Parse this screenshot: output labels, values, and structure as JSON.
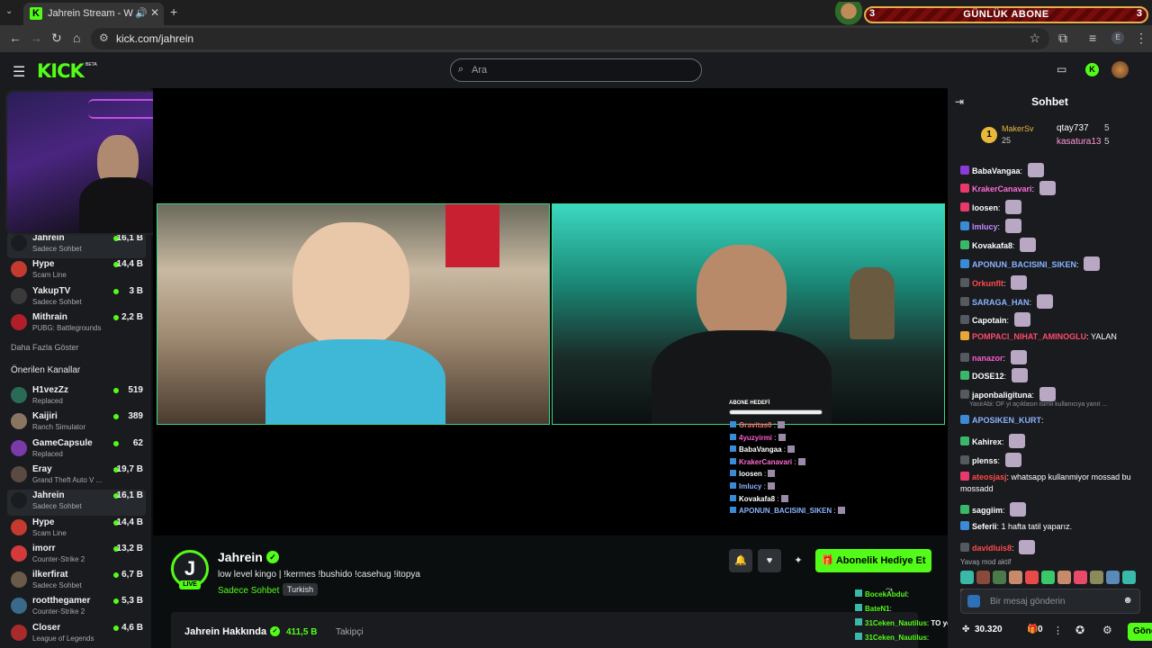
{
  "browser": {
    "tab_title": "Jahrein Stream - Watch Live",
    "url": "kick.com/jahrein",
    "new_tab_symbol": "+"
  },
  "sub_goal": {
    "label": "GÜNLÜK ABONE",
    "current": "3",
    "target": "3"
  },
  "header": {
    "logo": "KICK",
    "logo_badge": "BETA",
    "search_placeholder": "Ara"
  },
  "sidebar": {
    "followed": [
      {
        "name": "Jahrein",
        "sub": "Sadece Sohbet",
        "viewers": "16,1 B",
        "color": "#1a1d20"
      },
      {
        "name": "Hype",
        "sub": "Scam Line",
        "viewers": "14,4 B",
        "color": "#c43a2f"
      },
      {
        "name": "YakupTV",
        "sub": "Sadece Sohbet",
        "viewers": "3 B",
        "color": "#3a3a3a"
      },
      {
        "name": "Mithrain",
        "sub": "PUBG: Battlegrounds",
        "viewers": "2,2 B",
        "color": "#b01e2a"
      }
    ],
    "show_more": "Daha Fazla Göster",
    "recommended_title": "Önerilen Kanallar",
    "recommended": [
      {
        "name": "H1vezZz",
        "sub": "Replaced",
        "viewers": "519",
        "color": "#2a6b55"
      },
      {
        "name": "Kaijiri",
        "sub": "Ranch Simulator",
        "viewers": "389",
        "color": "#8a7560"
      },
      {
        "name": "GameCapsule",
        "sub": "Replaced",
        "viewers": "62",
        "color": "#7a3aa8"
      },
      {
        "name": "Eray",
        "sub": "Grand Theft Auto V ...",
        "viewers": "19,7 B",
        "color": "#5a4a42"
      },
      {
        "name": "Jahrein",
        "sub": "Sadece Sohbet",
        "viewers": "16,1 B",
        "color": "#1a1d20"
      },
      {
        "name": "Hype",
        "sub": "Scam Line",
        "viewers": "14,4 B",
        "color": "#c43a2f"
      },
      {
        "name": "imorr",
        "sub": "Counter-Strike 2",
        "viewers": "13,2 B",
        "color": "#d43a3a"
      },
      {
        "name": "ilkerfirat",
        "sub": "Sadece Sohbet",
        "viewers": "6,7 B",
        "color": "#6a5a4a"
      },
      {
        "name": "rootthegamer",
        "sub": "Counter-Strike 2",
        "viewers": "5,3 B",
        "color": "#3a6a8a"
      },
      {
        "name": "Closer",
        "sub": "League of Legends",
        "viewers": "4,6 B",
        "color": "#a82a2a"
      }
    ]
  },
  "stream": {
    "goal_title": "ABONE HEDEFİ",
    "overlay_chat": [
      {
        "user": "Gravitas0",
        "color": "#ff6b6b"
      },
      {
        "user": "4yuzyirmi",
        "color": "#ff5ad1"
      },
      {
        "user": "BabaVangaa",
        "color": "#ffffff"
      },
      {
        "user": "KrakerCanavari",
        "color": "#ff6bd6"
      },
      {
        "user": "loosen",
        "color": "#ffffff"
      },
      {
        "user": "lmlucy",
        "color": "#8ab4ff"
      },
      {
        "user": "Kovakafa8",
        "color": "#ffffff"
      },
      {
        "user": "APONUN_BACISINI_SIKEN",
        "color": "#8ab4ff"
      }
    ],
    "overlay_chat_2": [
      {
        "user": "BocekAbdul",
        "text": "",
        "color": "#53fc18"
      },
      {
        "user": "BateN1",
        "text": "",
        "color": "#53fc18"
      },
      {
        "user": "31Ceken_Nautilus",
        "text": "TO yemişim",
        "color": "#53fc18"
      },
      {
        "user": "31Ceken_Nautilus",
        "text": "",
        "color": "#53fc18"
      }
    ]
  },
  "channel": {
    "avatar_letter": "J",
    "live": "LIVE",
    "name": "Jahrein",
    "title": "low level kingo | !kermes !bushido !casehug !itopya",
    "category": "Sadece Sohbet",
    "language": "Turkish",
    "gift_button": "Abonelik Hediye Et",
    "about_title": "Jahrein Hakkında",
    "followers": "411,5 B",
    "followers_label": "Takipçi"
  },
  "chat": {
    "title": "Sohbet",
    "leaderboard": [
      {
        "user": "MakerSv",
        "count": "25"
      },
      {
        "user": "qtay737",
        "count": "5"
      },
      {
        "user": "kasatura13",
        "count": "5"
      }
    ],
    "messages": [
      {
        "user": "BabaVangaa",
        "text": "",
        "color": "#ffffff",
        "badge": "#8a3ad6",
        "emote": true
      },
      {
        "user": "KrakerCanavari",
        "text": "",
        "color": "#ff6bd6",
        "badge": "#e83a6a",
        "emote": true
      },
      {
        "user": "loosen",
        "text": "",
        "color": "#ffffff",
        "badge": "#e83a6a",
        "emote": true
      },
      {
        "user": "lmlucy",
        "text": "",
        "color": "#c28bff",
        "badge": "#3a8ad6",
        "emote": true
      },
      {
        "user": "Kovakafa8",
        "text": "",
        "color": "#ffffff",
        "badge": "#3ab86a",
        "emote": true
      },
      {
        "user": "APONUN_BACISINI_SIKEN",
        "text": "",
        "color": "#8ab4ff",
        "badge": "#3a8ad6",
        "emote": true
      },
      {
        "user": "Orkunflt",
        "text": "",
        "color": "#ff4a4a",
        "badge": "#555a60",
        "emote": true
      },
      {
        "user": "SARAGA_HAN",
        "text": "",
        "color": "#8ab4ff",
        "badge": "#555a60",
        "emote": true
      },
      {
        "user": "Capotain",
        "text": "",
        "color": "#ffffff",
        "badge": "#555a60",
        "emote": true
      },
      {
        "user": "POMPACI_NIHAT_AMINOGLU",
        "text": "YALAN",
        "color": "#ff4a6a",
        "badge": "#e8a63a",
        "emote": false
      },
      {
        "user": "nanazor",
        "text": "",
        "color": "#ff5ad1",
        "badge": "#555a60",
        "emote": true
      },
      {
        "user": "DOSE12",
        "text": "",
        "color": "#ffffff",
        "badge": "#3ab86a",
        "emote": true
      },
      {
        "user": "japonbaligituna",
        "text": "",
        "color": "#ffffff",
        "badge": "#555a60",
        "emote": true
      },
      {
        "user": "APOSIKEN_KURT",
        "text": "",
        "color": "#8ab4ff",
        "badge": "#3a8ad6",
        "emote": false
      },
      {
        "user": "Kahirex",
        "text": "",
        "color": "#ffffff",
        "badge": "#3ab86a",
        "emote": true
      },
      {
        "user": "plenss",
        "text": "",
        "color": "#ffffff",
        "badge": "#555a60",
        "emote": true
      },
      {
        "user": "ateosjasj",
        "text": "whatsapp kullanmiyor mossad bu mossadd",
        "color": "#ff4a4a",
        "badge": "#e83a6a",
        "emote": false
      },
      {
        "user": "saggiim",
        "text": "",
        "color": "#ffffff",
        "badge": "#3ab86a",
        "emote": true
      },
      {
        "user": "Seferii",
        "text": "1 hafta tatil yaparız.",
        "color": "#ffffff",
        "badge": "#3a8ad6",
        "emote": false
      },
      {
        "user": "davidluis8",
        "text": "",
        "color": "#ff4a4a",
        "badge": "#555a60",
        "emote": true
      }
    ],
    "reply_preview": "YasirAbi: OF yi açıklasın isimli kullanıcıya yanıt ...",
    "slow_mode": "Yavaş mod aktif",
    "input_placeholder": "Bir mesaj gönderin",
    "points": "30.320",
    "count": "0",
    "send": "Gönder"
  }
}
